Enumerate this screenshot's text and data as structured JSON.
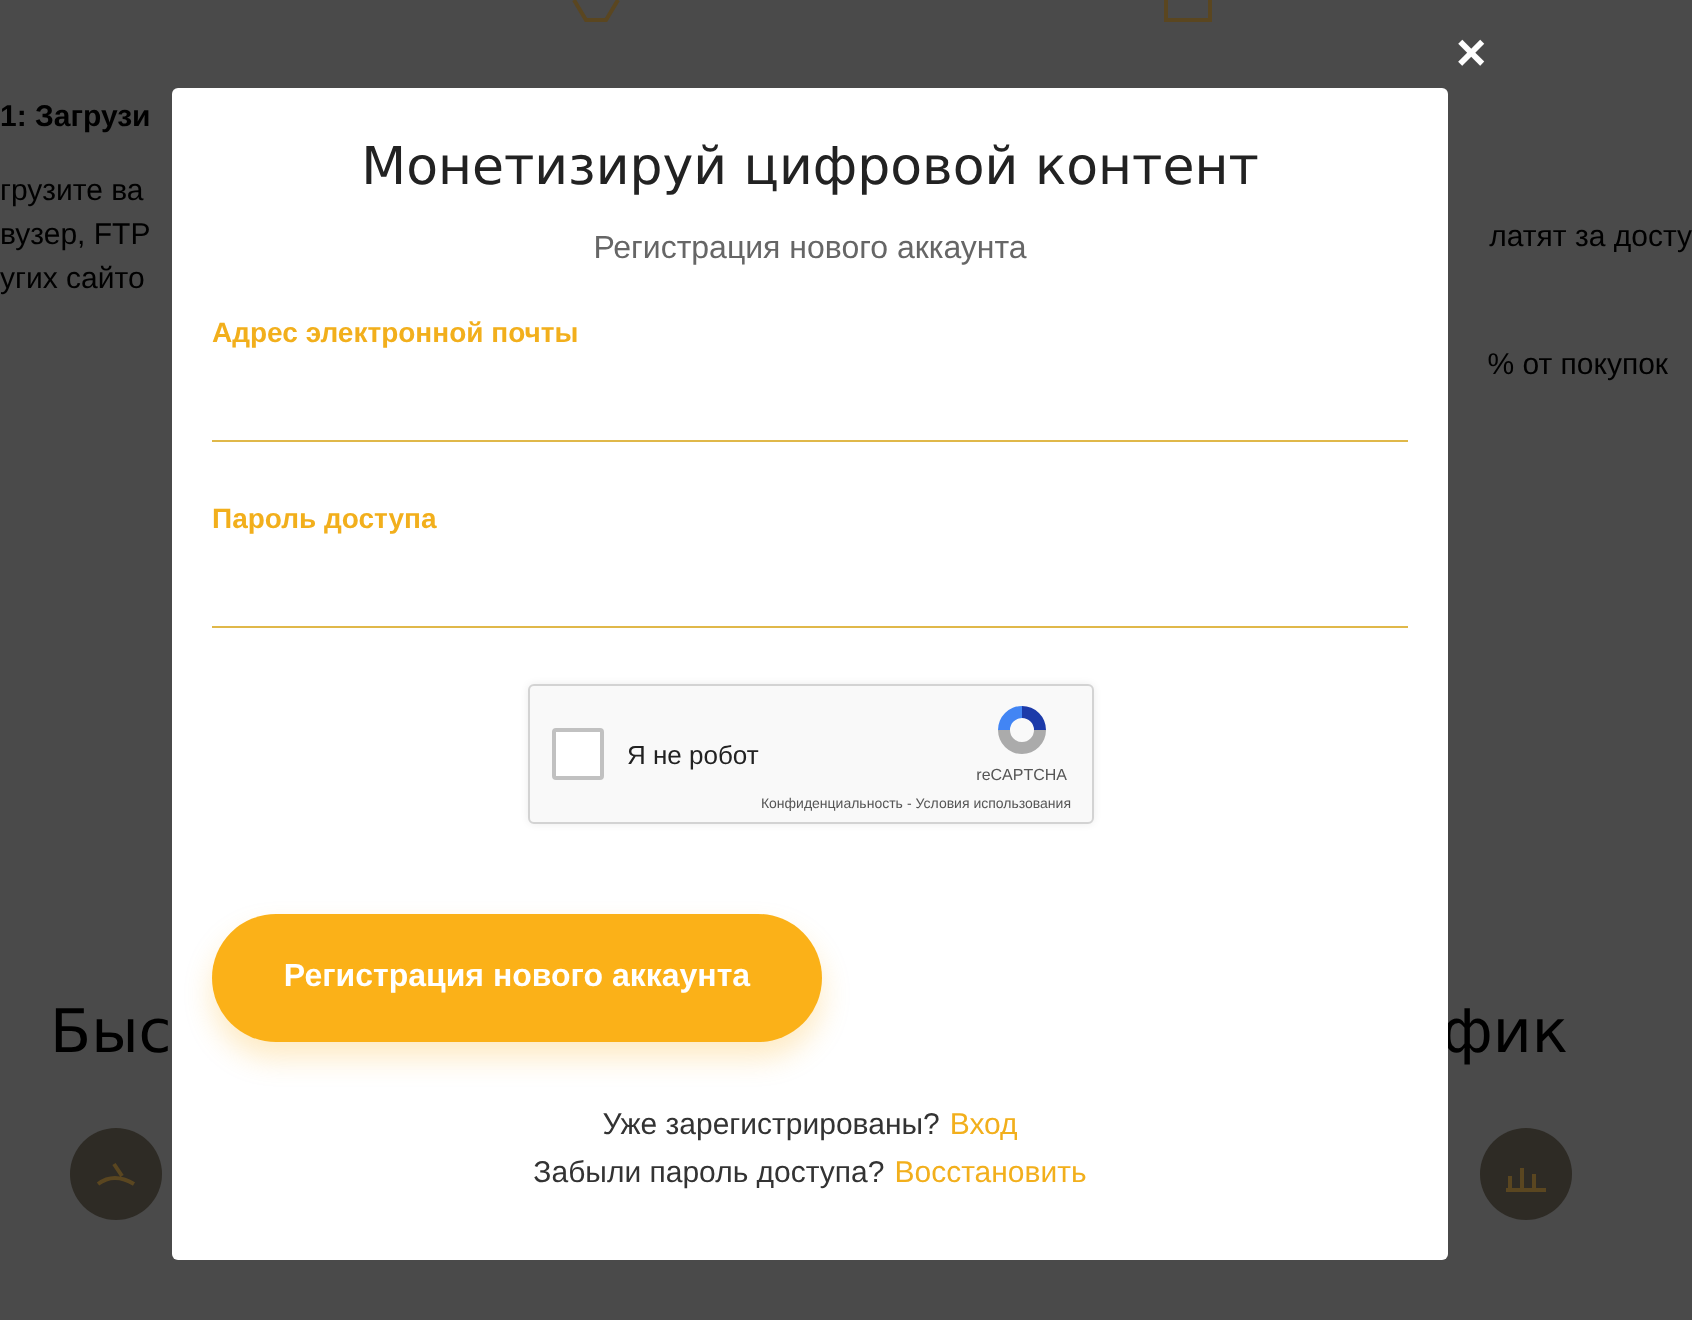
{
  "background_page": {
    "step_heading": "1: Загрузи",
    "left_lines": [
      "грузите ва",
      "вузер, FTP",
      "угих сайто"
    ],
    "right_lines": [
      "латят за досту",
      "% от покупок"
    ],
    "section_heading_left": "Быс",
    "section_heading_right": "фик"
  },
  "modal": {
    "close": "×",
    "title": "Монетизируй цифровой контент",
    "subtitle": "Регистрация нового аккаунта",
    "fields": [
      {
        "label": "Адрес электронной почты"
      },
      {
        "label": "Пароль доступа"
      }
    ],
    "captcha": {
      "label": "Я не робот",
      "checked": false,
      "brand": "reCAPTCHA",
      "privacy": "Конфиденциальность",
      "separator": "-",
      "terms": "Условия использования"
    },
    "submit": "Регистрация нового аккаунта",
    "links": [
      {
        "text": "Уже зарегистрированы?",
        "link": "Вход"
      },
      {
        "text": "Забыли пароль доступа?",
        "link": "Восстановить"
      }
    ]
  }
}
